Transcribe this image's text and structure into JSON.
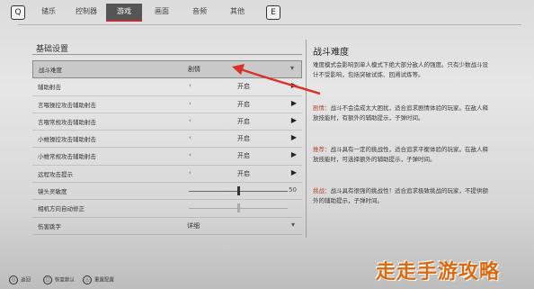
{
  "topbar": {
    "left_key": "Q",
    "right_key": "E",
    "tabs": [
      "储乐",
      "控制器",
      "游戏",
      "画面",
      "音频",
      "其他"
    ],
    "active_tab_index": 2
  },
  "settings": {
    "section_title": "基础设置",
    "rows": [
      {
        "label": "战斗难度",
        "type": "dropdown",
        "value": "剧情",
        "selected": true
      },
      {
        "label": "辅助射击",
        "type": "toggle",
        "value": "开启"
      },
      {
        "label": "言喂操控攻击辅助射击",
        "type": "toggle",
        "value": "开启"
      },
      {
        "label": "言喂常规攻击辅助射击",
        "type": "toggle",
        "value": "开启"
      },
      {
        "label": "小帷操控攻击辅助射击",
        "type": "toggle",
        "value": "开启"
      },
      {
        "label": "小帷常规攻击辅助射击",
        "type": "toggle",
        "value": "开启"
      },
      {
        "label": "远程攻击提示",
        "type": "toggle",
        "value": "开启"
      },
      {
        "label": "镜头灵敏度",
        "type": "slider",
        "value": "50",
        "level": 0.5
      },
      {
        "label": "相机方向自动修正",
        "type": "slider",
        "value": "",
        "level": 0.5,
        "dim": true
      },
      {
        "label": "伤害跳字",
        "type": "dropdown",
        "value": "详细"
      }
    ]
  },
  "info": {
    "title": "战斗难度",
    "paragraphs": [
      {
        "label": "",
        "text": "难度模式会影响到单人模式下绝大部分敌人的强度。只有少数战斗设计不受影响，包括突破试炼、回溯试炼等。"
      },
      {
        "label": "剧情：",
        "text": "战斗不会造成太大困扰，适合追求剧情体验的玩家。在敌人释放技能时，有额外的辅助提示，子弹时间。"
      },
      {
        "label": "推荐：",
        "text": "战斗具有一定的挑战性，适合追求平衡体验的玩家。在敌人释放技能时，可选择额外的辅助提示，子弹时间。"
      },
      {
        "label": "挑战：",
        "text": "战斗具有很强的挑战性！适合追求极致挑战的玩家，不提供额外的辅助提示，子弹时间。"
      }
    ]
  },
  "bottombar": {
    "hints": [
      {
        "key": "○",
        "label": "返回"
      },
      {
        "key": "□",
        "label": "恢复默认"
      },
      {
        "key": "△",
        "label": "重置配置"
      }
    ]
  },
  "watermark": "走走手游攻略",
  "colors": {
    "accent": "#b9323a",
    "annotation_red": "#d8322a",
    "watermark": "#d86a12"
  }
}
